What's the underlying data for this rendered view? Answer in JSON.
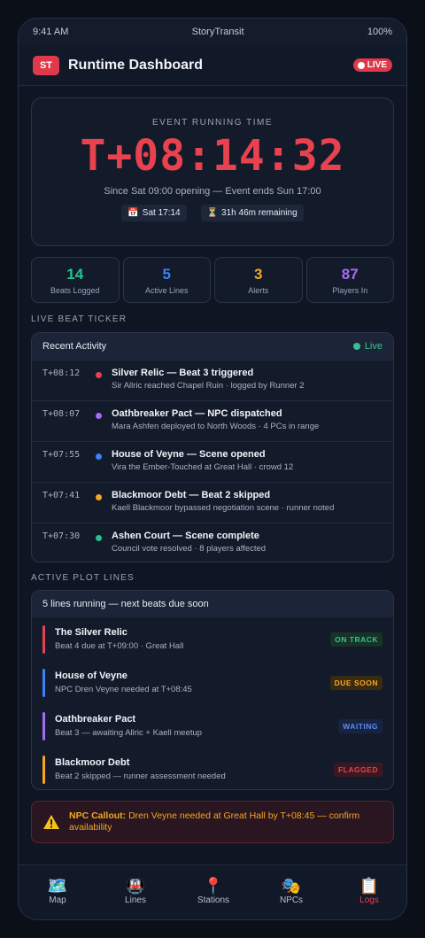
{
  "status": {
    "time": "9:41 AM",
    "app": "StoryTransit",
    "battery": "100%"
  },
  "header": {
    "logo": "ST",
    "title": "Runtime Dashboard",
    "live": "LIVE"
  },
  "timer": {
    "label": "EVENT RUNNING TIME",
    "value": "T+08:14:32",
    "since": "Since Sat 09:00 opening — Event ends Sun 17:00",
    "chip_date": "Sat 17:14",
    "chip_remaining": "31h 46m remaining"
  },
  "stats": [
    {
      "value": "14",
      "label": "Beats Logged",
      "color": "#22c38e"
    },
    {
      "value": "5",
      "label": "Active Lines",
      "color": "#3b82f6"
    },
    {
      "value": "3",
      "label": "Alerts",
      "color": "#f5a623"
    },
    {
      "value": "87",
      "label": "Players In",
      "color": "#a46cf5"
    }
  ],
  "ticker": {
    "section": "LIVE BEAT TICKER",
    "head": "Recent Activity",
    "live": "Live",
    "rows": [
      {
        "time": "T+08:12",
        "color": "#e8424f",
        "title": "Silver Relic — Beat 3 triggered",
        "sub": "Sir Allric reached Chapel Ruin · logged by Runner 2"
      },
      {
        "time": "T+08:07",
        "color": "#a46cf5",
        "title": "Oathbreaker Pact — NPC dispatched",
        "sub": "Mara Ashfen deployed to North Woods · 4 PCs in range"
      },
      {
        "time": "T+07:55",
        "color": "#3b82f6",
        "title": "House of Veyne — Scene opened",
        "sub": "Vira the Ember-Touched at Great Hall · crowd 12"
      },
      {
        "time": "T+07:41",
        "color": "#f5a623",
        "title": "Blackmoor Debt — Beat 2 skipped",
        "sub": "Kaell Blackmoor bypassed negotiation scene · runner noted"
      },
      {
        "time": "T+07:30",
        "color": "#22c38e",
        "title": "Ashen Court — Scene complete",
        "sub": "Council vote resolved · 8 players affected"
      }
    ]
  },
  "plots": {
    "section": "ACTIVE PLOT LINES",
    "head": "5 lines running — next beats due soon",
    "rows": [
      {
        "color": "#e8424f",
        "title": "The Silver Relic",
        "sub": "Beat 4 due at T+09:00 · Great Hall",
        "badge": "ON TRACK",
        "badge_fg": "#34c38f",
        "badge_bg": "#163326"
      },
      {
        "color": "#3b82f6",
        "title": "House of Veyne",
        "sub": "NPC Dren Veyne needed at T+08:45",
        "badge": "DUE SOON",
        "badge_fg": "#f5a623",
        "badge_bg": "#3a2a12"
      },
      {
        "color": "#a46cf5",
        "title": "Oathbreaker Pact",
        "sub": "Beat 3 — awaiting Allric + Kaell meetup",
        "badge": "WAITING",
        "badge_fg": "#5b8def",
        "badge_bg": "#172341"
      },
      {
        "color": "#f5a623",
        "title": "Blackmoor Debt",
        "sub": "Beat 2 skipped — runner assessment needed",
        "badge": "FLAGGED",
        "badge_fg": "#e8424f",
        "badge_bg": "#3a1820"
      }
    ]
  },
  "callout": {
    "lead": "NPC Callout:",
    "text": "Dren Veyne needed at Great Hall by T+08:45 — confirm availability"
  },
  "tabs": [
    {
      "icon": "map-icon",
      "glyph": "🗺️",
      "label": "Map"
    },
    {
      "icon": "train-icon",
      "glyph": "🚇",
      "label": "Lines"
    },
    {
      "icon": "pin-icon",
      "glyph": "📍",
      "label": "Stations"
    },
    {
      "icon": "mask-icon",
      "glyph": "🎭",
      "label": "NPCs"
    },
    {
      "icon": "clipboard-icon",
      "glyph": "📋",
      "label": "Logs"
    }
  ]
}
